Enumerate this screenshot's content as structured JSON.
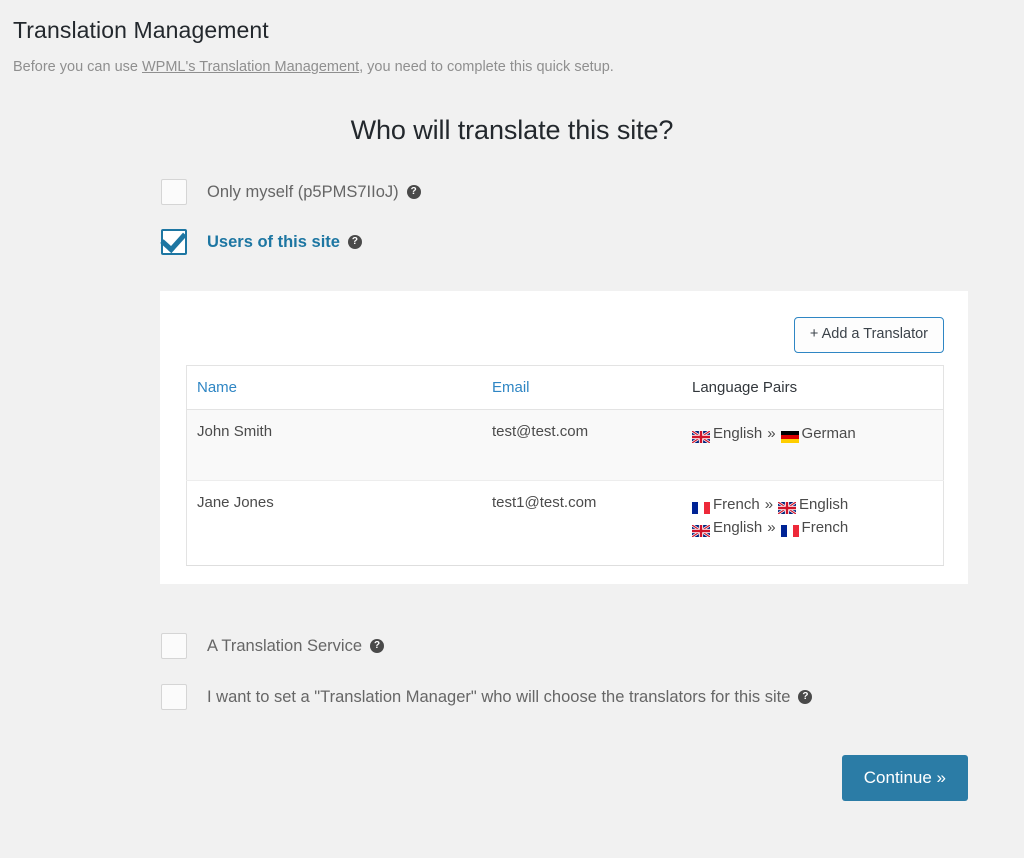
{
  "header": {
    "title": "Translation Management",
    "subtitle_before": "Before you can use ",
    "subtitle_link": "WPML's Translation Management",
    "subtitle_after": ", you need to complete this quick setup."
  },
  "section": {
    "heading": "Who will translate this site?"
  },
  "options": [
    {
      "id": "only-myself",
      "label": "Only myself (p5PMS7IIoJ)",
      "checked": false,
      "help": "?"
    },
    {
      "id": "users-of-this-site",
      "label": "Users of this site",
      "checked": true,
      "help": "?"
    },
    {
      "id": "translation-service",
      "label": "A Translation Service",
      "checked": false,
      "help": "?"
    },
    {
      "id": "translation-manager",
      "label": "I want to set a \"Translation Manager\" who will choose the translators for this site",
      "checked": false,
      "help": "?"
    }
  ],
  "panel": {
    "add_translator_label": "+ Add a Translator",
    "table": {
      "columns": [
        "Name",
        "Email",
        "Language Pairs"
      ],
      "rows": [
        {
          "name": "John Smith",
          "email": "test@test.com",
          "pairs": [
            {
              "from": "English",
              "from_flag": "uk",
              "arrow": "»",
              "to": "German",
              "to_flag": "de"
            }
          ]
        },
        {
          "name": "Jane Jones",
          "email": "test1@test.com",
          "pairs": [
            {
              "from": "French",
              "from_flag": "fr",
              "arrow": "»",
              "to": "English",
              "to_flag": "uk"
            },
            {
              "from": "English",
              "from_flag": "uk",
              "arrow": "»",
              "to": "French",
              "to_flag": "fr"
            }
          ]
        }
      ]
    }
  },
  "footer": {
    "continue_label": "Continue »"
  },
  "colors": {
    "accent_blue": "#1d76a2",
    "link_blue": "#2f86c4",
    "button_blue": "#2b7ca6",
    "page_background": "#f1f1f1",
    "panel_background": "#ffffff",
    "text_dark": "#23282d",
    "text_muted": "#8f8f8f"
  }
}
